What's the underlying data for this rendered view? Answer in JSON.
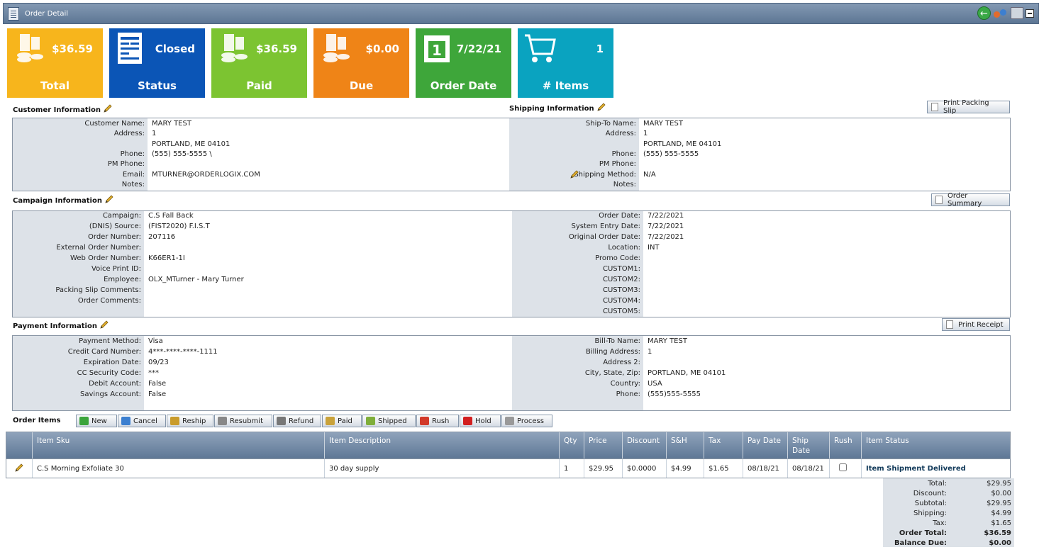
{
  "window": {
    "title": "Order Detail"
  },
  "tiles": [
    {
      "value": "$36.59",
      "label": "Total",
      "color": "#f7b51c"
    },
    {
      "value": "Closed",
      "label": "Status",
      "color": "#0b55b6"
    },
    {
      "value": "$36.59",
      "label": "Paid",
      "color": "#7cc431"
    },
    {
      "value": "$0.00",
      "label": "Due",
      "color": "#ef8417"
    },
    {
      "value": "7/22/21",
      "label": "Order Date",
      "color": "#3ea63a"
    },
    {
      "value": "1",
      "label": "# Items",
      "color": "#0aa3c0"
    }
  ],
  "customer": {
    "title": "Customer Information",
    "rows": [
      {
        "k": "Customer Name:",
        "v": "MARY TEST"
      },
      {
        "k": "Address:",
        "v": "1"
      },
      {
        "k": "",
        "v": "PORTLAND, ME 04101"
      },
      {
        "k": "Phone:",
        "v": "(555) 555-5555 \\"
      },
      {
        "k": "PM Phone:",
        "v": ""
      },
      {
        "k": "Email:",
        "v": "MTURNER@ORDERLOGIX.COM"
      },
      {
        "k": "Notes:",
        "v": ""
      }
    ]
  },
  "shipping": {
    "title": "Shipping Information",
    "print_button": "Print Packing Slip",
    "rows": [
      {
        "k": "Ship-To Name:",
        "v": "MARY TEST"
      },
      {
        "k": "Address:",
        "v": "1"
      },
      {
        "k": "",
        "v": "PORTLAND, ME 04101"
      },
      {
        "k": "Phone:",
        "v": "(555) 555-5555"
      },
      {
        "k": "PM Phone:",
        "v": ""
      },
      {
        "k": "Shipping Method:",
        "v": "N/A"
      },
      {
        "k": "Notes:",
        "v": ""
      }
    ]
  },
  "campaign": {
    "title": "Campaign Information",
    "summary_button": "Order Summary",
    "left": [
      {
        "k": "Campaign:",
        "v": "C.S Fall Back"
      },
      {
        "k": "(DNIS) Source:",
        "v": "(FIST2020) F.I.S.T"
      },
      {
        "k": "Order Number:",
        "v": "207116"
      },
      {
        "k": "External Order Number:",
        "v": ""
      },
      {
        "k": "Web Order Number:",
        "v": "K66ER1-1I"
      },
      {
        "k": "Voice Print ID:",
        "v": ""
      },
      {
        "k": "Employee:",
        "v": "OLX_MTurner - Mary Turner"
      },
      {
        "k": "Packing Slip Comments:",
        "v": ""
      },
      {
        "k": "Order Comments:",
        "v": ""
      }
    ],
    "right": [
      {
        "k": "Order Date:",
        "v": "7/22/2021"
      },
      {
        "k": "System Entry Date:",
        "v": "7/22/2021"
      },
      {
        "k": "Original Order Date:",
        "v": "7/22/2021"
      },
      {
        "k": "Location:",
        "v": "INT"
      },
      {
        "k": "Promo Code:",
        "v": ""
      },
      {
        "k": "CUSTOM1:",
        "v": ""
      },
      {
        "k": "CUSTOM2:",
        "v": ""
      },
      {
        "k": "CUSTOM3:",
        "v": ""
      },
      {
        "k": "CUSTOM4:",
        "v": ""
      },
      {
        "k": "CUSTOM5:",
        "v": ""
      }
    ]
  },
  "payment": {
    "title": "Payment Information",
    "receipt_button": "Print Receipt",
    "left": [
      {
        "k": "Payment Method:",
        "v": "Visa"
      },
      {
        "k": "Credit Card Number:",
        "v": "4***-****-****-1111"
      },
      {
        "k": "Expiration Date:",
        "v": "09/23"
      },
      {
        "k": "CC Security Code:",
        "v": "***"
      },
      {
        "k": "Debit Account:",
        "v": "False"
      },
      {
        "k": "Savings Account:",
        "v": "False"
      }
    ],
    "right": [
      {
        "k": "Bill-To Name:",
        "v": "MARY TEST"
      },
      {
        "k": "Billing Address:",
        "v": "1"
      },
      {
        "k": "Address 2:",
        "v": ""
      },
      {
        "k": "City, State, Zip:",
        "v": "PORTLAND, ME 04101"
      },
      {
        "k": "Country:",
        "v": "USA"
      },
      {
        "k": "Phone:",
        "v": "(555)555-5555"
      }
    ]
  },
  "order_items": {
    "title": "Order Items",
    "toolbar": [
      "New",
      "Cancel",
      "Reship",
      "Resubmit",
      "Refund",
      "Paid",
      "Shipped",
      "Rush",
      "Hold",
      "Process"
    ],
    "columns": [
      "Item Sku",
      "Item Description",
      "Qty",
      "Price",
      "Discount",
      "S&H",
      "Tax",
      "Pay Date",
      "Ship Date",
      "Rush",
      "Item Status"
    ],
    "rows": [
      {
        "sku": "C.S Morning Exfoliate 30",
        "description": "30 day supply",
        "qty": "1",
        "price": "$29.95",
        "discount": "$0.0000",
        "sh": "$4.99",
        "tax": "$1.65",
        "pay_date": "08/18/21",
        "ship_date": "08/18/21",
        "rush": false,
        "status": "Item Shipment Delivered"
      }
    ]
  },
  "totals": [
    {
      "k": "Total:",
      "v": "$29.95",
      "bold": false
    },
    {
      "k": "Discount:",
      "v": "$0.00",
      "bold": false
    },
    {
      "k": "Subtotal:",
      "v": "$29.95",
      "bold": false
    },
    {
      "k": "Shipping:",
      "v": "$4.99",
      "bold": false
    },
    {
      "k": "Tax:",
      "v": "$1.65",
      "bold": false
    },
    {
      "k": "Order Total:",
      "v": "$36.59",
      "bold": true
    },
    {
      "k": "Balance Due:",
      "v": "$0.00",
      "bold": true
    }
  ]
}
